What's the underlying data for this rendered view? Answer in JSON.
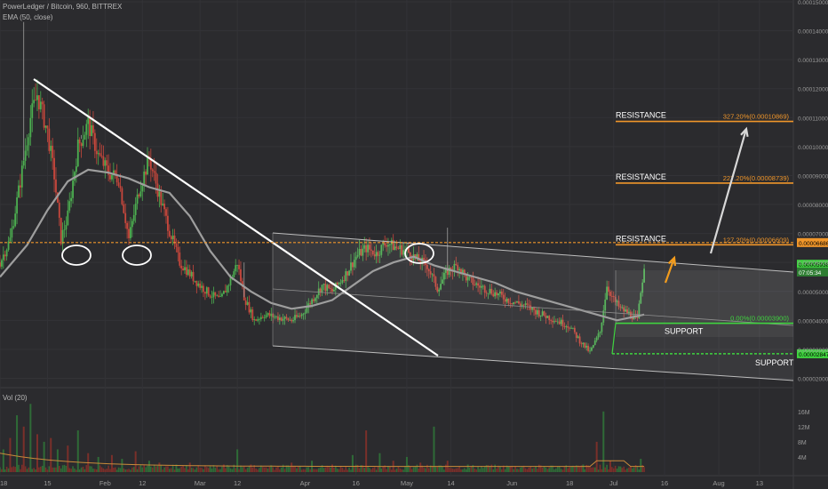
{
  "header": {
    "symbol": "PowerLedger / Bitcoin, 960, BITTREX",
    "indicator": "EMA (50, close)",
    "volume_label": "Vol (20)"
  },
  "colors": {
    "background": "#2b2b2e",
    "grid": "#333337",
    "candle_up": "#4caf50",
    "candle_down": "#c8473c",
    "ema": "#9e9e9e",
    "trendline": "#ffffff",
    "channel": "#bdbdbd",
    "fib": "#f0962a",
    "support": "#3fd43f",
    "arrow_white": "#d8d8d8",
    "arrow_orange": "#f39c1d",
    "price_dashed": "#f0962a"
  },
  "chart_data": {
    "type": "candlestick",
    "x_axis": {
      "tick_labels": [
        "2018",
        "15",
        "Feb",
        "12",
        "Mar",
        "12",
        "Apr",
        "16",
        "May",
        "14",
        "Jun",
        "18",
        "Jul",
        "16",
        "Aug",
        "13"
      ],
      "tick_days": [
        0,
        14,
        31,
        42,
        59,
        70,
        90,
        105,
        120,
        133,
        151,
        168,
        181,
        196,
        212,
        224
      ],
      "range_days": [
        0,
        234
      ]
    },
    "y_axis": {
      "scale": "linear",
      "ylim": [
        1.8e-05,
        0.00015
      ],
      "tick_labels": [
        "0.00002000",
        "0.00003000",
        "0.00004000",
        "0.00005000",
        "0.00006000",
        "0.00007000",
        "0.00008000",
        "0.00009000",
        "0.00010000",
        "0.00011000",
        "0.00012000",
        "0.00013000",
        "0.00014000",
        "0.00015000"
      ],
      "tick_values": [
        2e-05,
        3e-05,
        4e-05,
        5e-05,
        6e-05,
        7e-05,
        8e-05,
        9e-05,
        0.0001,
        0.00011,
        0.00012,
        0.00013,
        0.00014,
        0.00015
      ]
    },
    "price_path": [
      [
        0,
        6e-05
      ],
      [
        3,
        6.8e-05
      ],
      [
        6,
        8.8e-05
      ],
      [
        9,
        0.00011
      ],
      [
        11,
        0.000118
      ],
      [
        14,
        0.000105
      ],
      [
        16,
        9e-05
      ],
      [
        18,
        6.8e-05
      ],
      [
        20,
        7.6e-05
      ],
      [
        23,
        0.0001
      ],
      [
        26,
        0.000108
      ],
      [
        29,
        9.7e-05
      ],
      [
        32,
        9.1e-05
      ],
      [
        35,
        8.9e-05
      ],
      [
        38,
        6.8e-05
      ],
      [
        41,
        8.5e-05
      ],
      [
        44,
        9.6e-05
      ],
      [
        47,
        8.3e-05
      ],
      [
        50,
        7.1e-05
      ],
      [
        53,
        6e-05
      ],
      [
        56,
        5.6e-05
      ],
      [
        59,
        5.2e-05
      ],
      [
        62,
        4.9e-05
      ],
      [
        65,
        4.7e-05
      ],
      [
        68,
        5.4e-05
      ],
      [
        70,
        6e-05
      ],
      [
        72,
        4.8e-05
      ],
      [
        75,
        4e-05
      ],
      [
        78,
        4.2e-05
      ],
      [
        82,
        4.1e-05
      ],
      [
        86,
        4e-05
      ],
      [
        89,
        4.2e-05
      ],
      [
        92,
        4.7e-05
      ],
      [
        95,
        5.2e-05
      ],
      [
        98,
        5e-05
      ],
      [
        102,
        5.6e-05
      ],
      [
        105,
        6.2e-05
      ],
      [
        108,
        6.5e-05
      ],
      [
        111,
        6.3e-05
      ],
      [
        114,
        6.7e-05
      ],
      [
        117,
        6.5e-05
      ],
      [
        120,
        6.4e-05
      ],
      [
        123,
        6.1e-05
      ],
      [
        126,
        5.9e-05
      ],
      [
        129,
        5.1e-05
      ],
      [
        132,
        5.7e-05
      ],
      [
        135,
        5.9e-05
      ],
      [
        138,
        5.4e-05
      ],
      [
        141,
        5.2e-05
      ],
      [
        145,
        5e-05
      ],
      [
        150,
        4.7e-05
      ],
      [
        155,
        4.5e-05
      ],
      [
        160,
        4.2e-05
      ],
      [
        164,
        4e-05
      ],
      [
        168,
        3.8e-05
      ],
      [
        171,
        3.3e-05
      ],
      [
        174,
        2.9e-05
      ],
      [
        177,
        3.6e-05
      ],
      [
        179,
        5.2e-05
      ],
      [
        181,
        4.7e-05
      ],
      [
        183,
        4.4e-05
      ],
      [
        186,
        4.2e-05
      ],
      [
        188,
        4e-05
      ],
      [
        190,
        5.9e-05
      ]
    ],
    "ema_path": [
      [
        0,
        5.5e-05
      ],
      [
        8,
        6.6e-05
      ],
      [
        14,
        7.8e-05
      ],
      [
        20,
        8.8e-05
      ],
      [
        26,
        9.2e-05
      ],
      [
        32,
        9.1e-05
      ],
      [
        38,
        8.9e-05
      ],
      [
        44,
        8.6e-05
      ],
      [
        50,
        8.4e-05
      ],
      [
        56,
        7.6e-05
      ],
      [
        62,
        6.4e-05
      ],
      [
        68,
        5.5e-05
      ],
      [
        74,
        5e-05
      ],
      [
        80,
        4.6e-05
      ],
      [
        86,
        4.4e-05
      ],
      [
        92,
        4.5e-05
      ],
      [
        98,
        4.7e-05
      ],
      [
        104,
        5.2e-05
      ],
      [
        110,
        5.7e-05
      ],
      [
        116,
        6e-05
      ],
      [
        122,
        6.2e-05
      ],
      [
        128,
        5.9e-05
      ],
      [
        134,
        5.7e-05
      ],
      [
        140,
        5.5e-05
      ],
      [
        146,
        5.3e-05
      ],
      [
        152,
        5e-05
      ],
      [
        158,
        4.8e-05
      ],
      [
        164,
        4.6e-05
      ],
      [
        170,
        4.4e-05
      ],
      [
        176,
        4.2e-05
      ],
      [
        182,
        4e-05
      ],
      [
        190,
        4.2e-05
      ]
    ],
    "volume_axis": {
      "tick_labels": [
        "16M",
        "12M",
        "8M",
        "4M"
      ],
      "tick_values": [
        16000000,
        12000000,
        8000000,
        4000000
      ],
      "ylim": [
        0,
        19000000
      ]
    },
    "volume_spikes": [
      [
        1,
        6000000
      ],
      [
        3,
        9000000
      ],
      [
        5,
        15000000
      ],
      [
        7,
        12000000
      ],
      [
        9,
        18000000
      ],
      [
        11,
        10000000
      ],
      [
        13,
        8000000
      ],
      [
        15,
        9000000
      ],
      [
        17,
        6000000
      ],
      [
        20,
        7000000
      ],
      [
        23,
        11000000
      ],
      [
        26,
        5000000
      ],
      [
        29,
        4000000
      ],
      [
        33,
        4500000
      ],
      [
        36,
        3500000
      ],
      [
        40,
        5500000
      ],
      [
        44,
        3000000
      ],
      [
        47,
        2500000
      ],
      [
        52,
        2000000
      ],
      [
        56,
        2500000
      ],
      [
        62,
        1500000
      ],
      [
        66,
        2000000
      ],
      [
        70,
        6000000
      ],
      [
        74,
        2000000
      ],
      [
        80,
        1800000
      ],
      [
        86,
        2500000
      ],
      [
        92,
        3000000
      ],
      [
        98,
        2000000
      ],
      [
        104,
        4500000
      ],
      [
        108,
        11000000
      ],
      [
        112,
        5000000
      ],
      [
        116,
        3000000
      ],
      [
        120,
        4000000
      ],
      [
        124,
        2500000
      ],
      [
        128,
        12000000
      ],
      [
        132,
        3000000
      ],
      [
        138,
        2000000
      ],
      [
        144,
        1800000
      ],
      [
        150,
        1500000
      ],
      [
        156,
        1200000
      ],
      [
        162,
        1000000
      ],
      [
        168,
        1300000
      ],
      [
        172,
        2000000
      ],
      [
        176,
        8000000
      ],
      [
        178,
        16000000
      ],
      [
        180,
        3000000
      ],
      [
        183,
        1500000
      ],
      [
        186,
        1500000
      ],
      [
        189,
        3500000
      ]
    ],
    "annotations": {
      "resistance_text": "RESISTANCE",
      "support_text": "SUPPORT",
      "fib_levels": [
        {
          "label": "327.20%(0.00010869)",
          "value": 0.00010869
        },
        {
          "label": "227.20%(0.00008739)",
          "value": 8.739e-05
        },
        {
          "label": "127.20%(0.00006609)",
          "value": 6.609e-05
        },
        {
          "label": "0.00%(0.00003900)",
          "value": 3.9e-05
        }
      ],
      "price_labels": [
        {
          "label": "0.00006686",
          "value": 6.686e-05
        },
        {
          "label": "0.00005938",
          "value": 5.938e-05
        },
        {
          "label": "07:05:34",
          "value": 5.67e-05
        },
        {
          "label": "0.00002847",
          "value": 2.847e-05
        }
      ],
      "horizontal_dashed_price": 6.686e-05,
      "lower_support": 2.847e-05
    }
  }
}
